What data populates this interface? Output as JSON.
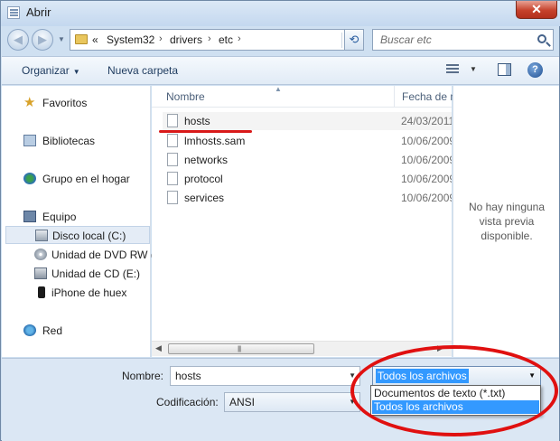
{
  "window": {
    "title": "Abrir",
    "close_label": "✕"
  },
  "nav": {
    "back_icon": "back-arrow-icon",
    "forward_icon": "forward-arrow-icon",
    "overflow": "«",
    "breadcrumbs": [
      "System32",
      "drivers",
      "etc"
    ],
    "search_placeholder": "Buscar etc"
  },
  "toolbar": {
    "organize": "Organizar",
    "new_folder": "Nueva carpeta"
  },
  "sidebar": {
    "items": [
      {
        "label": "Favoritos",
        "icon": "star-icon"
      },
      {
        "label": "Bibliotecas",
        "icon": "library-icon"
      },
      {
        "label": "Grupo en el hogar",
        "icon": "homegroup-icon"
      },
      {
        "label": "Equipo",
        "icon": "computer-icon"
      },
      {
        "label": "Disco local (C:)",
        "icon": "hard-disk-icon"
      },
      {
        "label": "Unidad de DVD RW (",
        "icon": "dvd-drive-icon"
      },
      {
        "label": "Unidad de CD (E:)",
        "icon": "cd-drive-icon"
      },
      {
        "label": "iPhone de huex",
        "icon": "phone-icon"
      },
      {
        "label": "Red",
        "icon": "network-icon"
      }
    ]
  },
  "files": {
    "columns": {
      "name": "Nombre",
      "date": "Fecha de m"
    },
    "rows": [
      {
        "name": "hosts",
        "date": "24/03/2011"
      },
      {
        "name": "lmhosts.sam",
        "date": "10/06/2009"
      },
      {
        "name": "networks",
        "date": "10/06/2009"
      },
      {
        "name": "protocol",
        "date": "10/06/2009"
      },
      {
        "name": "services",
        "date": "10/06/2009"
      }
    ]
  },
  "preview": {
    "text": "No hay ninguna vista previa disponible."
  },
  "bottom": {
    "name_label": "Nombre:",
    "name_value": "hosts",
    "file_type_value": "Todos los archivos",
    "encoding_label": "Codificación:",
    "encoding_value": "ANSI",
    "file_type_options": [
      "Documentos de texto (*.txt)",
      "Todos los archivos"
    ],
    "selected_option": "Todos los archivos"
  },
  "colors": {
    "annotation_red": "#e01010",
    "selection_blue": "#3399ff",
    "window_frame": "#cfe0f1"
  }
}
